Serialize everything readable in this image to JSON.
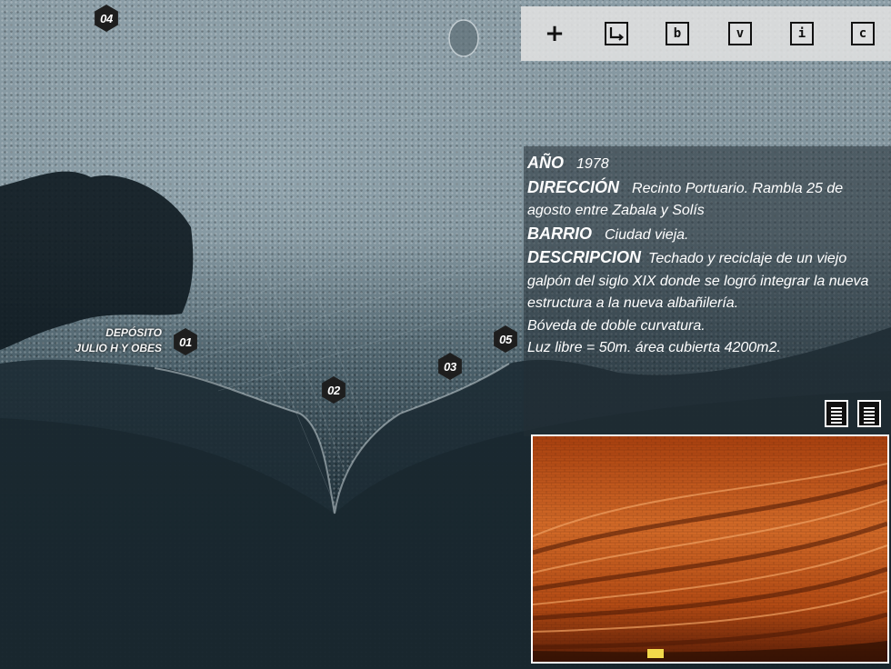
{
  "markers": [
    {
      "num": "04"
    },
    {
      "num": "01"
    },
    {
      "num": "02"
    },
    {
      "num": "03"
    },
    {
      "num": "05"
    }
  ],
  "place_label": {
    "line1": "DEPÓSITO",
    "line2": "JULIO H Y OBES"
  },
  "toolbar": {
    "add_icon": "plus-icon",
    "items": [
      {
        "icon": "return-arrow-icon"
      },
      {
        "letter": "b"
      },
      {
        "letter": "v"
      },
      {
        "letter": "i"
      },
      {
        "letter": "c"
      }
    ]
  },
  "info": {
    "year_label": "AÑO",
    "year_value": "1978",
    "address_label": "DIRECCIÓN",
    "address_value": "Recinto Portuario. Rambla 25 de agosto entre Zabala y Solís",
    "barrio_label": "BARRIO",
    "barrio_value": "Ciudad vieja.",
    "desc_label": "DESCRIPCION",
    "desc_value": "Techado y reciclaje de un viejo galpón del siglo XIX donde se logró integrar la nueva estructura a la nueva albañilería.",
    "line_boveda": "Bóveda de doble curvatura.",
    "line_luz": "Luz libre = 50m. área cubierta 4200m2."
  },
  "doc_icons": [
    "document-icon",
    "document-icon"
  ],
  "photo": {
    "subject": "brick vault ceiling photo"
  },
  "colors": {
    "toolbar_bg": "#e1e1e1",
    "marker_bg": "#1e1e1e",
    "text": "#ffffff",
    "photo_brick": "#c4541a"
  }
}
